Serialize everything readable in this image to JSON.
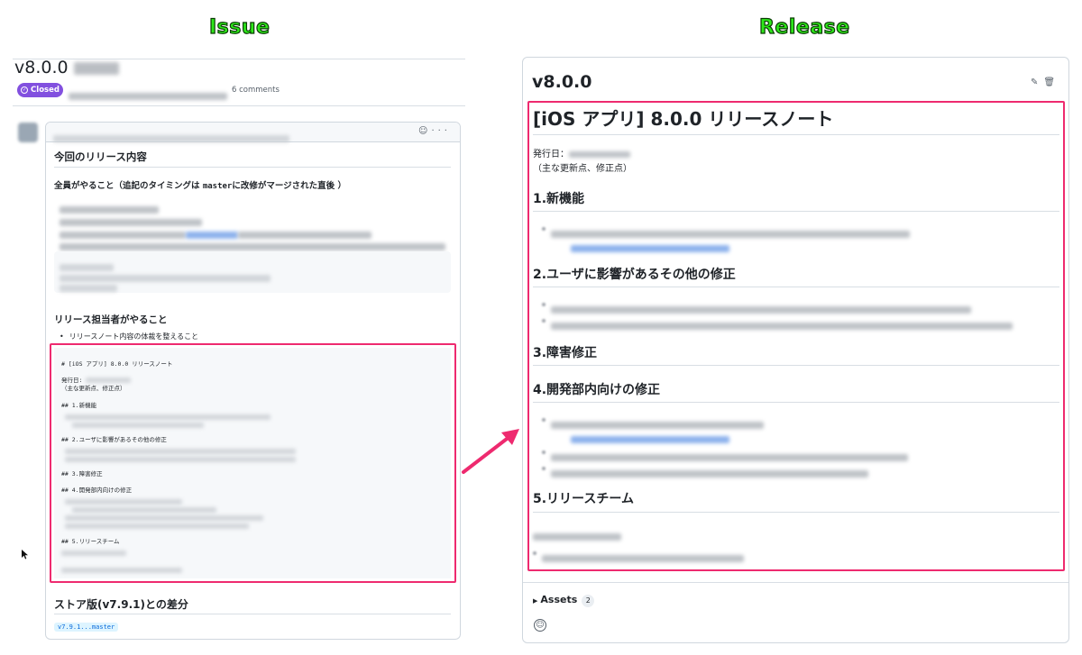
{
  "captions": {
    "issue": "Issue",
    "release": "Release"
  },
  "issue": {
    "title": "v8.0.0",
    "status": "Closed",
    "comments": "6 comments",
    "heading_main": "今回のリリース内容",
    "heading_all_prefix": "全員がやること（追記のタイミングは ",
    "heading_all_code": "master",
    "heading_all_suffix": "に改修がマージされた直後 ）",
    "heading_release_owner": "リリース担当者がやること",
    "owner_item": "リリースノート内容の体裁を整えること",
    "code_lines": {
      "title": "# [iOS アプリ] 8.0.0 リリースノート",
      "date": "発行日:",
      "summary": "（主な更新点、修正点）",
      "h1": "## 1.新機能",
      "h2": "## 2.ユーザに影響があるその他の修正",
      "h3": "## 3.障害修正",
      "h4": "## 4.開発部内向けの修正",
      "h5": "## 5.リリースチーム"
    },
    "store_diff_heading": "ストア版(v7.9.1)との差分",
    "compare_link": "v7.9.1...master"
  },
  "release": {
    "version": "v8.0.0",
    "notes_title": "[iOS アプリ] 8.0.0 リリースノート",
    "date_label": "発行日：",
    "summary": "（主な更新点、修正点）",
    "sections": [
      "1.新機能",
      "2.ユーザに影響があるその他の修正",
      "3.障害修正",
      "4.開発部内向けの修正",
      "5.リリースチーム"
    ],
    "assets_label": "Assets",
    "assets_count": "2"
  },
  "colors": {
    "closed": "#8250df",
    "highlight": "#ee2a6f",
    "caption": "#2ee81a",
    "link": "#0969da"
  },
  "icons": [
    "check-circle-icon",
    "smiley-icon",
    "kebab-icon",
    "pencil-icon",
    "trash-icon",
    "triangle-right-icon",
    "cursor-icon",
    "arrow-icon"
  ]
}
